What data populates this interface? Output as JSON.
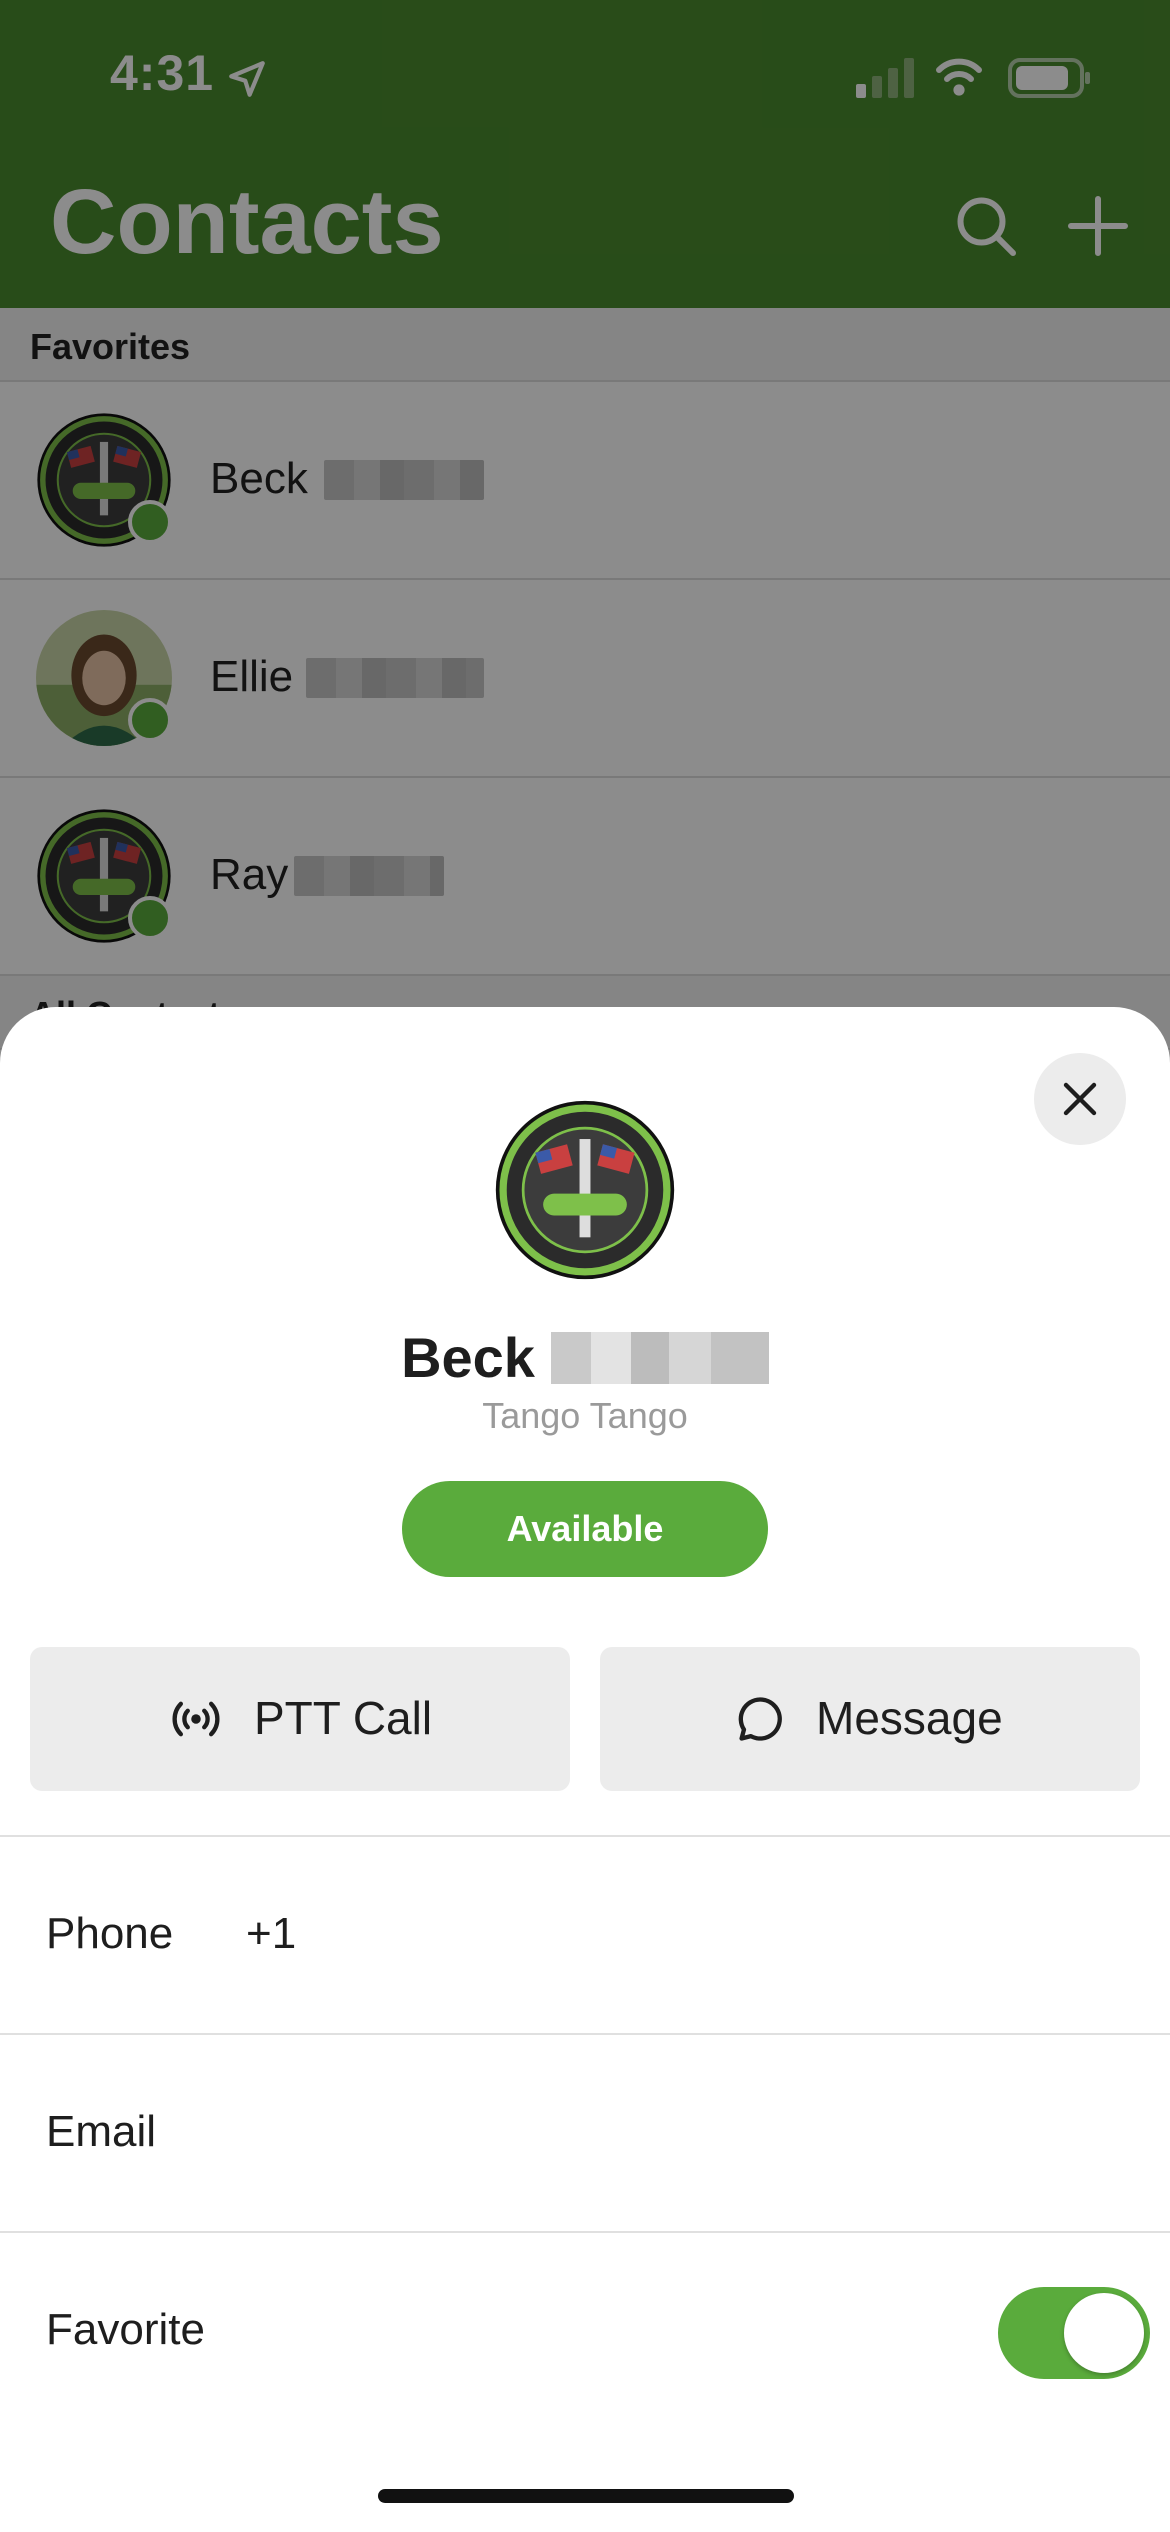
{
  "status_bar": {
    "time": "4:31"
  },
  "header": {
    "title": "Contacts"
  },
  "favorites": {
    "header": "Favorites",
    "contacts": [
      {
        "name": "Beck"
      },
      {
        "name": "Ellie"
      },
      {
        "name": "Ray"
      }
    ]
  },
  "all_contacts": {
    "header": "All Contacts"
  },
  "sheet": {
    "name": "Beck",
    "organization": "Tango Tango",
    "status": "Available",
    "actions": {
      "ptt_label": "PTT Call",
      "message_label": "Message"
    },
    "details": {
      "phone_label": "Phone",
      "phone_value": "+1",
      "email_label": "Email",
      "favorite_label": "Favorite",
      "favorite_on": true
    }
  },
  "colors": {
    "brand_green": "#4a8a2e",
    "accent_green": "#5aab3c",
    "button_gray": "#ececec"
  },
  "icons": {
    "status_bar": [
      "location-arrow-icon",
      "signal-icon",
      "wifi-icon",
      "battery-icon"
    ],
    "header": [
      "search-icon",
      "plus-icon"
    ],
    "sheet": [
      "close-icon",
      "ptt-broadcast-icon",
      "message-bubble-icon"
    ]
  }
}
